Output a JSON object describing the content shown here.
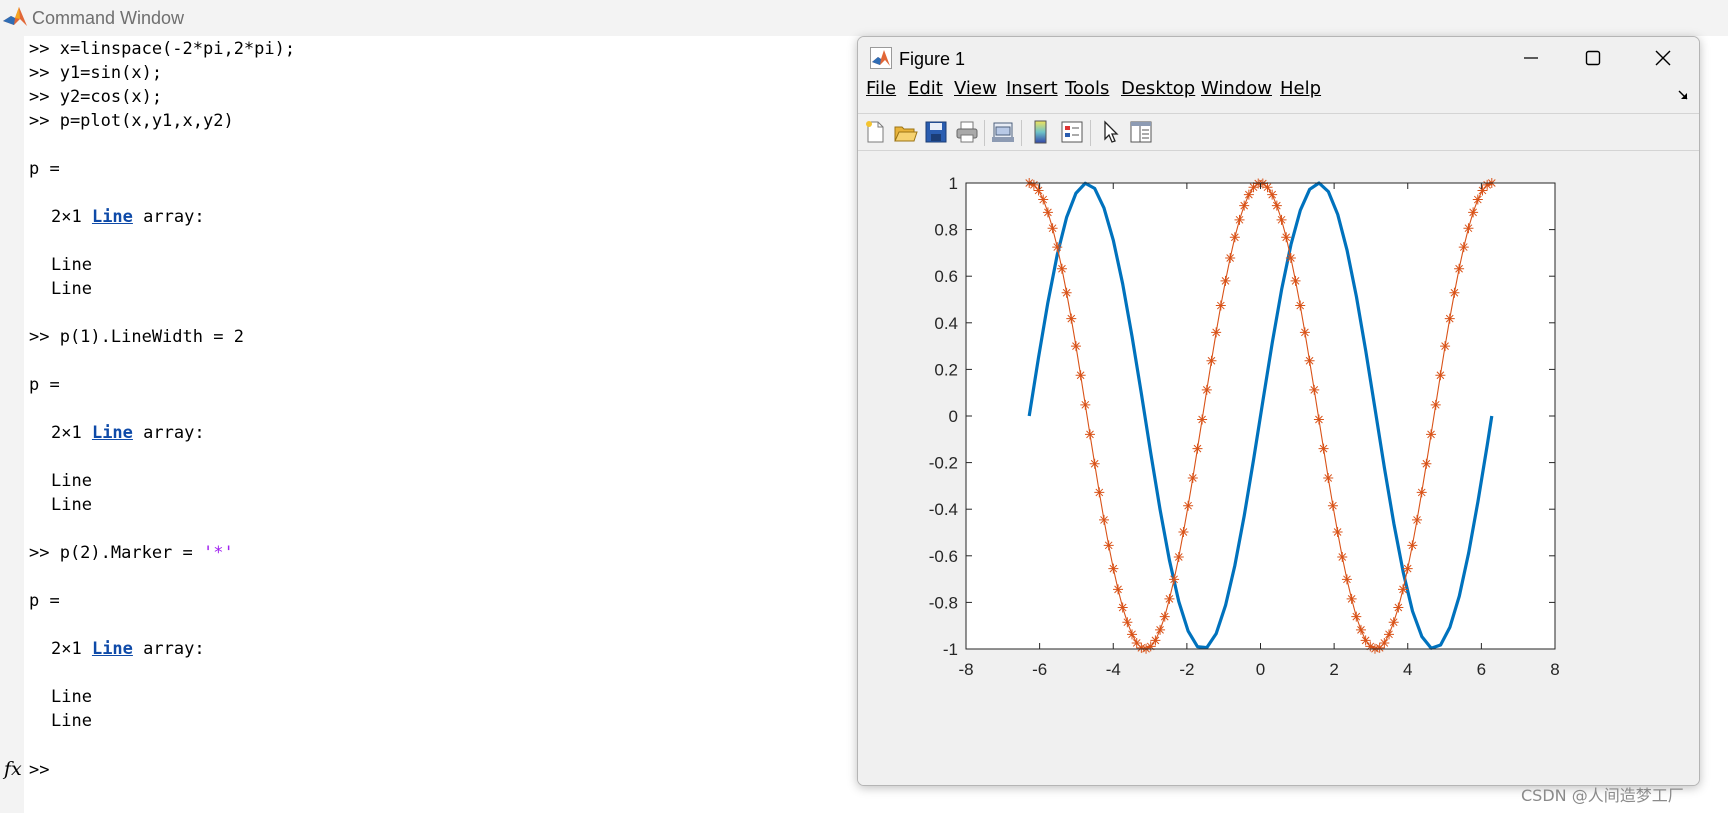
{
  "command_window": {
    "title": "Command Window",
    "lines": [
      ">> x=linspace(-2*pi,2*pi);",
      ">> y1=sin(x);",
      ">> y2=cos(x);",
      ">> p=plot(x,y1,x,y2)",
      "p =",
      "2×1 ",
      "Line",
      " array:",
      "Line",
      "Line",
      ">> p(1).LineWidth = 2",
      "p =",
      "2×1 ",
      "Line",
      " array:",
      "Line",
      "Line",
      ">> p(2).Marker = ",
      "'*'",
      "p =",
      "2×1 ",
      "Line",
      " array:",
      "Line",
      "Line"
    ],
    "fx_icon": "fx",
    "prompt": ">>"
  },
  "figure": {
    "title": "Figure 1",
    "window_buttons": [
      "minimize-icon",
      "maximize-icon",
      "close-icon"
    ],
    "menu": [
      "File",
      "Edit",
      "View",
      "Insert",
      "Tools",
      "Desktop",
      "Window",
      "Help"
    ],
    "toolbar_icons": [
      "new-figure-icon",
      "open-file-icon",
      "save-icon",
      "print-icon",
      "link-plot-icon",
      "colorbar-icon",
      "legend-icon",
      "edit-plot-icon",
      "property-editor-icon"
    ]
  },
  "chart_data": {
    "type": "line",
    "title": "",
    "xlabel": "",
    "ylabel": "",
    "xlim": [
      -8,
      8
    ],
    "ylim": [
      -1,
      1
    ],
    "xticks": [
      -8,
      -6,
      -4,
      -2,
      0,
      2,
      4,
      6,
      8
    ],
    "yticks": [
      -1,
      -0.8,
      -0.6,
      -0.4,
      -0.2,
      0,
      0.2,
      0.4,
      0.6,
      0.8,
      1
    ],
    "xtick_labels": [
      "-8",
      "-6",
      "-4",
      "-2",
      "0",
      "2",
      "4",
      "6",
      "8"
    ],
    "ytick_labels": [
      "-1",
      "-0.8",
      "-0.6",
      "-0.4",
      "-0.2",
      "0",
      "0.2",
      "0.4",
      "0.6",
      "0.8",
      "1"
    ],
    "grid": false,
    "box": true,
    "series": [
      {
        "color": "#0072bd",
        "line_width": 2,
        "marker": "none",
        "x": [
          -6.283,
          -6.03,
          -5.776,
          -5.522,
          -5.268,
          -5.014,
          -4.76,
          -4.506,
          -4.252,
          -3.998,
          -3.744,
          -3.49,
          -3.236,
          -2.982,
          -2.728,
          -2.474,
          -2.22,
          -1.966,
          -1.712,
          -1.458,
          -1.204,
          -0.95,
          -0.696,
          -0.442,
          -0.188,
          0.066,
          0.32,
          0.574,
          0.828,
          1.082,
          1.336,
          1.59,
          1.844,
          2.098,
          2.352,
          2.606,
          2.86,
          3.114,
          3.368,
          3.622,
          3.876,
          4.13,
          4.384,
          4.638,
          4.892,
          5.146,
          5.4,
          5.654,
          5.908,
          6.162,
          6.283
        ],
        "y": [
          0.0,
          0.251,
          0.487,
          0.692,
          0.852,
          0.956,
          0.999,
          0.977,
          0.893,
          0.754,
          0.567,
          0.342,
          0.096,
          -0.159,
          -0.402,
          -0.619,
          -0.796,
          -0.923,
          -0.99,
          -0.994,
          -0.934,
          -0.813,
          -0.641,
          -0.428,
          -0.187,
          0.066,
          0.315,
          0.543,
          0.736,
          0.883,
          0.973,
          1.0,
          0.963,
          0.865,
          0.711,
          0.512,
          0.279,
          0.028,
          -0.224,
          -0.461,
          -0.67,
          -0.838,
          -0.947,
          -0.997,
          -0.983,
          -0.906,
          -0.773,
          -0.588,
          -0.366,
          -0.122,
          0.0
        ]
      },
      {
        "color": "#d95319",
        "line_width": 0.5,
        "marker": "*",
        "x": [
          -6.283,
          -6.156,
          -6.029,
          -5.902,
          -5.775,
          -5.648,
          -5.521,
          -5.394,
          -5.267,
          -5.14,
          -5.013,
          -4.886,
          -4.759,
          -4.632,
          -4.505,
          -4.378,
          -4.251,
          -4.124,
          -3.997,
          -3.87,
          -3.744,
          -3.617,
          -3.49,
          -3.363,
          -3.236,
          -3.109,
          -2.982,
          -2.855,
          -2.728,
          -2.601,
          -2.474,
          -2.347,
          -2.22,
          -2.093,
          -1.966,
          -1.839,
          -1.712,
          -1.586,
          -1.459,
          -1.332,
          -1.205,
          -1.078,
          -0.951,
          -0.824,
          -0.697,
          -0.57,
          -0.443,
          -0.316,
          -0.189,
          -0.062,
          0.063,
          0.19,
          0.317,
          0.444,
          0.571,
          0.698,
          0.825,
          0.952,
          1.079,
          1.206,
          1.333,
          1.46,
          1.587,
          1.713,
          1.84,
          1.967,
          2.094,
          2.221,
          2.348,
          2.475,
          2.602,
          2.729,
          2.856,
          2.983,
          3.11,
          3.237,
          3.364,
          3.491,
          3.618,
          3.745,
          3.871,
          3.998,
          4.125,
          4.252,
          4.379,
          4.506,
          4.633,
          4.76,
          4.887,
          5.014,
          5.141,
          5.268,
          5.395,
          5.522,
          5.649,
          5.776,
          5.903,
          6.03,
          6.157,
          6.283
        ],
        "y": [
          1.0,
          0.992,
          0.968,
          0.929,
          0.874,
          0.806,
          0.725,
          0.632,
          0.529,
          0.418,
          0.3,
          0.175,
          0.048,
          -0.079,
          -0.205,
          -0.328,
          -0.446,
          -0.555,
          -0.655,
          -0.744,
          -0.822,
          -0.885,
          -0.937,
          -0.974,
          -0.995,
          -0.999,
          -0.989,
          -0.963,
          -0.918,
          -0.861,
          -0.785,
          -0.701,
          -0.605,
          -0.498,
          -0.385,
          -0.266,
          -0.14,
          -0.015,
          0.112,
          0.237,
          0.359,
          0.474,
          0.58,
          0.678,
          0.767,
          0.842,
          0.903,
          0.95,
          0.982,
          0.998,
          0.998,
          0.982,
          0.95,
          0.903,
          0.842,
          0.767,
          0.678,
          0.58,
          0.474,
          0.359,
          0.237,
          0.112,
          -0.015,
          -0.14,
          -0.266,
          -0.385,
          -0.498,
          -0.605,
          -0.701,
          -0.785,
          -0.861,
          -0.918,
          -0.963,
          -0.989,
          -0.999,
          -0.995,
          -0.974,
          -0.937,
          -0.885,
          -0.822,
          -0.744,
          -0.655,
          -0.555,
          -0.446,
          -0.328,
          -0.205,
          -0.079,
          0.048,
          0.175,
          0.3,
          0.418,
          0.529,
          0.632,
          0.725,
          0.806,
          0.874,
          0.929,
          0.968,
          0.992,
          1.0
        ]
      }
    ]
  },
  "watermark": "CSDN @人间造梦工厂"
}
